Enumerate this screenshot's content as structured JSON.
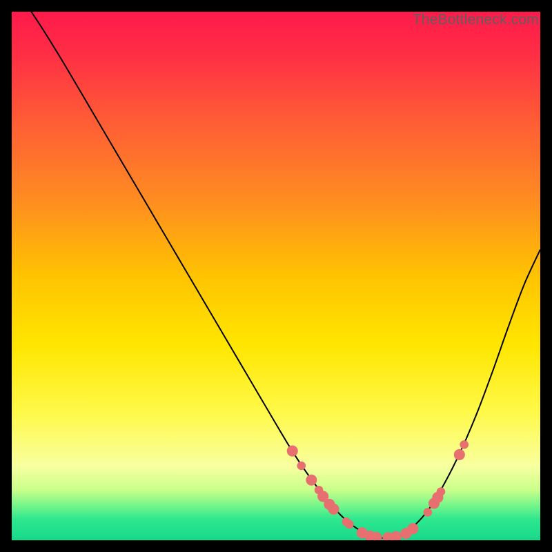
{
  "watermark": "TheBottleneck.com",
  "colors": {
    "marker": "#e76f6f",
    "curve": "#000000",
    "gradient_stops": [
      {
        "offset": 0.0,
        "color": "#ff1a4b"
      },
      {
        "offset": 0.08,
        "color": "#ff2e45"
      },
      {
        "offset": 0.2,
        "color": "#ff5a36"
      },
      {
        "offset": 0.35,
        "color": "#ff8a22"
      },
      {
        "offset": 0.5,
        "color": "#ffc300"
      },
      {
        "offset": 0.63,
        "color": "#ffe600"
      },
      {
        "offset": 0.76,
        "color": "#fff94a"
      },
      {
        "offset": 0.86,
        "color": "#f8ffa0"
      },
      {
        "offset": 0.905,
        "color": "#c9ff8a"
      },
      {
        "offset": 0.935,
        "color": "#73f58a"
      },
      {
        "offset": 0.96,
        "color": "#2fe78f"
      },
      {
        "offset": 1.0,
        "color": "#17d98a"
      }
    ]
  },
  "chart_data": {
    "type": "line",
    "title": "",
    "xlabel": "",
    "ylabel": "",
    "xlim": [
      0,
      100
    ],
    "ylim": [
      0,
      100
    ],
    "series": [
      {
        "name": "bottleneck-curve",
        "x": [
          3.7,
          6,
          10,
          15,
          20,
          25,
          30,
          35,
          40,
          45,
          50,
          53,
          56,
          59,
          62,
          64.5,
          67,
          69.5,
          72,
          74,
          76,
          79,
          82,
          85,
          88,
          91,
          94,
          97,
          100
        ],
        "y": [
          100,
          96.5,
          90,
          81.5,
          73,
          64.5,
          56,
          47.5,
          39,
          30.5,
          22,
          17,
          12.5,
          8.5,
          5,
          2.8,
          1.3,
          0.5,
          0.5,
          1.2,
          2.6,
          6,
          11,
          17,
          24,
          32,
          40.5,
          48.5,
          55
        ]
      }
    ],
    "markers": {
      "name": "data-points",
      "points": [
        {
          "x": 53.1,
          "y": 16.9,
          "r": 1.05
        },
        {
          "x": 54.8,
          "y": 14.1,
          "r": 0.82
        },
        {
          "x": 56.7,
          "y": 11.4,
          "r": 1.05
        },
        {
          "x": 58.1,
          "y": 9.5,
          "r": 0.82
        },
        {
          "x": 58.9,
          "y": 8.3,
          "r": 1.05
        },
        {
          "x": 60.1,
          "y": 6.8,
          "r": 1.05
        },
        {
          "x": 60.9,
          "y": 5.9,
          "r": 1.05
        },
        {
          "x": 63.3,
          "y": 3.5,
          "r": 0.82
        },
        {
          "x": 63.9,
          "y": 3.0,
          "r": 0.82
        },
        {
          "x": 66.3,
          "y": 1.4,
          "r": 1.05
        },
        {
          "x": 67.8,
          "y": 0.8,
          "r": 1.05
        },
        {
          "x": 69.0,
          "y": 0.55,
          "r": 1.05
        },
        {
          "x": 71.2,
          "y": 0.5,
          "r": 1.05
        },
        {
          "x": 72.7,
          "y": 0.7,
          "r": 1.05
        },
        {
          "x": 74.6,
          "y": 1.3,
          "r": 1.05
        },
        {
          "x": 75.9,
          "y": 2.2,
          "r": 1.05
        },
        {
          "x": 78.7,
          "y": 5.3,
          "r": 0.82
        },
        {
          "x": 79.9,
          "y": 7.0,
          "r": 1.05
        },
        {
          "x": 80.6,
          "y": 8.1,
          "r": 1.05
        },
        {
          "x": 81.2,
          "y": 9.2,
          "r": 0.82
        },
        {
          "x": 84.7,
          "y": 16.2,
          "r": 1.05
        },
        {
          "x": 85.6,
          "y": 18.1,
          "r": 0.82
        }
      ]
    }
  }
}
